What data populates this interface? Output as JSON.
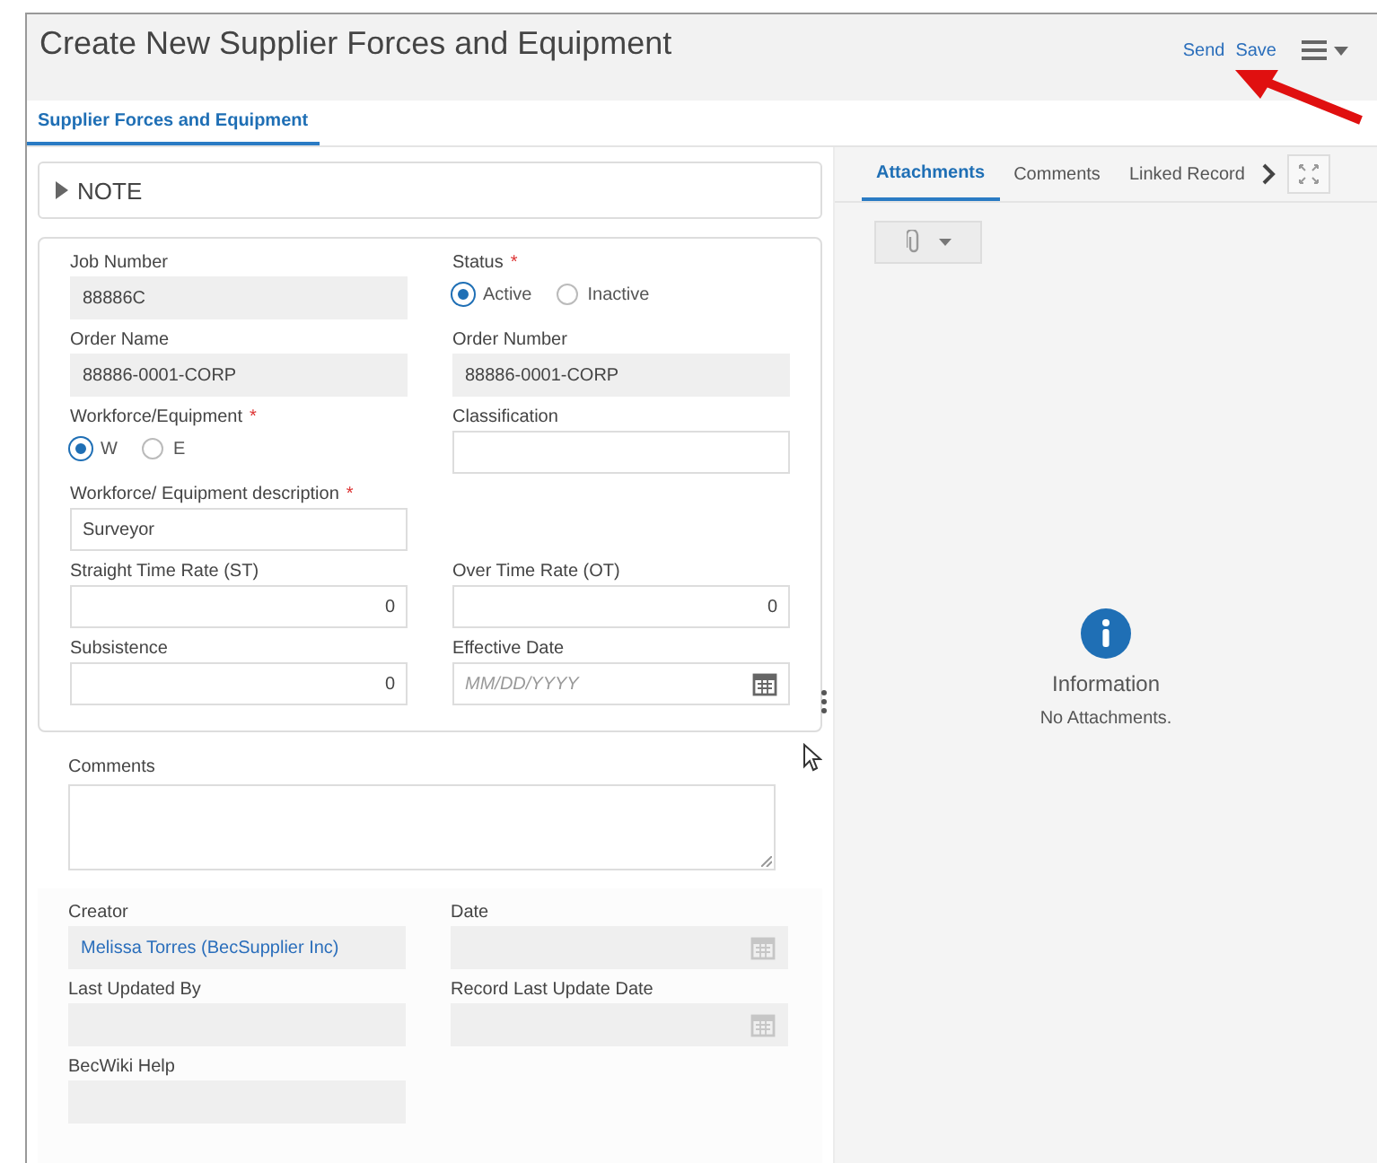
{
  "window": {
    "title": "Create New Supplier Forces and Equipment"
  },
  "actions": [
    {
      "label": "Send"
    },
    {
      "label": "Save"
    }
  ],
  "tabs": [
    {
      "label": "Supplier Forces and Equipment",
      "selected": true
    }
  ],
  "note": {
    "label": "NOTE",
    "expanded": false
  },
  "main_rows": [
    [
      {
        "kind": "text",
        "label": "Job Number",
        "value": "88886C",
        "readonly": true
      },
      {
        "kind": "radio",
        "label": "Status",
        "required_mark": "*",
        "options": [
          {
            "label": "Active",
            "selected": true
          },
          {
            "label": "Inactive",
            "selected": false
          }
        ]
      }
    ],
    [
      {
        "kind": "text",
        "label": "Order Name",
        "value": "88886-0001-CORP",
        "readonly": true
      },
      {
        "kind": "text",
        "label": "Order Number",
        "value": "88886-0001-CORP",
        "readonly": true
      }
    ],
    [
      {
        "kind": "radio",
        "label": "Workforce/Equipment",
        "required_mark": "*",
        "options": [
          {
            "label": "W",
            "selected": true
          },
          {
            "label": "E",
            "selected": false
          }
        ]
      },
      {
        "kind": "text",
        "label": "Classification",
        "readonly": false
      }
    ],
    [
      {
        "kind": "text",
        "label": "Workforce/ Equipment description",
        "required_mark": "*",
        "value": "Surveyor",
        "readonly": false
      }
    ],
    [
      {
        "kind": "number",
        "label": "Straight Time Rate (ST)",
        "value": "0",
        "readonly": false
      },
      {
        "kind": "number",
        "label": "Over Time Rate (OT)",
        "value": "0",
        "readonly": false
      }
    ],
    [
      {
        "kind": "number",
        "label": "Subsistence",
        "value": "0",
        "readonly": false
      },
      {
        "kind": "date",
        "label": "Effective Date",
        "placeholder": "MM/DD/YYYY",
        "readonly": false
      }
    ]
  ],
  "comments": {
    "label": "Comments"
  },
  "audit_rows": [
    [
      {
        "kind": "link",
        "label": "Creator",
        "value": "Melissa Torres (BecSupplier Inc)",
        "readonly": true
      },
      {
        "kind": "date",
        "label": "Date",
        "readonly": true
      }
    ],
    [
      {
        "kind": "text",
        "label": "Last Updated By",
        "readonly": true
      },
      {
        "kind": "date",
        "label": "Record Last Update Date",
        "readonly": true
      }
    ],
    [
      {
        "kind": "text",
        "label": "BecWiki Help",
        "readonly": true
      }
    ]
  ],
  "side_tabs": [
    {
      "label": "Attachments",
      "selected": true
    },
    {
      "label": "Comments",
      "selected": false
    },
    {
      "label": "Linked Record",
      "selected": false
    }
  ],
  "empty_state": {
    "title": "Information",
    "message": "No Attachments."
  }
}
